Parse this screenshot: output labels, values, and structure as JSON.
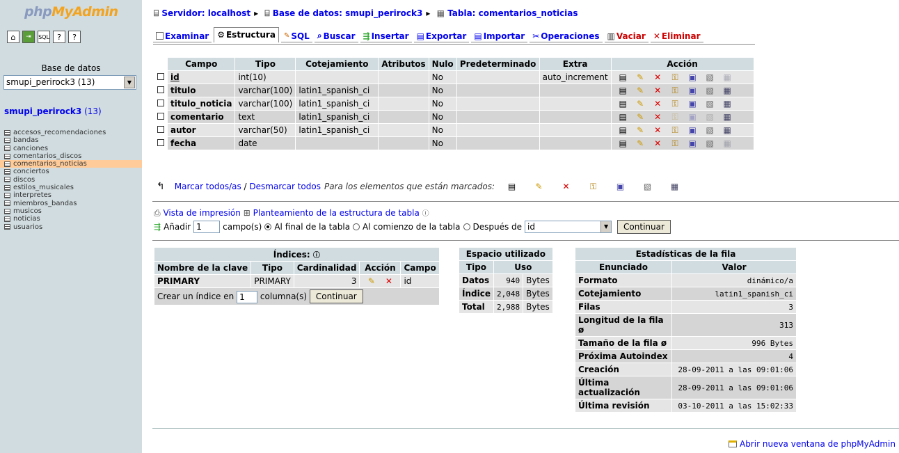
{
  "sidebar": {
    "logo_php": "php",
    "logo_myadmin": "MyAdmin",
    "db_label": "Base de datos",
    "db_select": "smupi_perirock3 (13)",
    "db_title": "smupi_perirock3",
    "db_count": "(13)",
    "tables": [
      "accesos_recomendaciones",
      "bandas",
      "canciones",
      "comentarios_discos",
      "comentarios_noticias",
      "conciertos",
      "discos",
      "estilos_musicales",
      "interpretes",
      "miembros_bandas",
      "musicos",
      "noticias",
      "usuarios"
    ],
    "selected_table": "comentarios_noticias"
  },
  "breadcrumb": {
    "server": "Servidor: localhost",
    "database": "Base de datos: smupi_perirock3",
    "table": "Tabla: comentarios_noticias"
  },
  "tabs": [
    "Examinar",
    "Estructura",
    "SQL",
    "Buscar",
    "Insertar",
    "Exportar",
    "Importar",
    "Operaciones",
    "Vaciar",
    "Eliminar"
  ],
  "structure": {
    "headers": [
      "Campo",
      "Tipo",
      "Cotejamiento",
      "Atributos",
      "Nulo",
      "Predeterminado",
      "Extra",
      "Acción"
    ],
    "rows": [
      {
        "campo": "id",
        "tipo": "int(10)",
        "cotejamiento": "",
        "atributos": "",
        "nulo": "No",
        "pred": "",
        "extra": "auto_increment"
      },
      {
        "campo": "titulo",
        "tipo": "varchar(100)",
        "cotejamiento": "latin1_spanish_ci",
        "atributos": "",
        "nulo": "No",
        "pred": "",
        "extra": ""
      },
      {
        "campo": "titulo_noticia",
        "tipo": "varchar(100)",
        "cotejamiento": "latin1_spanish_ci",
        "atributos": "",
        "nulo": "No",
        "pred": "",
        "extra": ""
      },
      {
        "campo": "comentario",
        "tipo": "text",
        "cotejamiento": "latin1_spanish_ci",
        "atributos": "",
        "nulo": "No",
        "pred": "",
        "extra": ""
      },
      {
        "campo": "autor",
        "tipo": "varchar(50)",
        "cotejamiento": "latin1_spanish_ci",
        "atributos": "",
        "nulo": "No",
        "pred": "",
        "extra": ""
      },
      {
        "campo": "fecha",
        "tipo": "date",
        "cotejamiento": "",
        "atributos": "",
        "nulo": "No",
        "pred": "",
        "extra": ""
      }
    ],
    "mark_all": "Marcar todos/as",
    "slash": "/",
    "unmark_all": "Desmarcar todos",
    "selected_hint": "Para los elementos que están marcados:"
  },
  "links": {
    "print_view": "Vista de impresión",
    "plan": "Planteamiento de la estructura de tabla"
  },
  "add": {
    "label": "Añadir",
    "count": "1",
    "fields_text": "campo(s)",
    "opt_end": "Al final de la tabla",
    "opt_start": "Al comienzo de la tabla",
    "opt_after": "Después de",
    "after_value": "id",
    "button": "Continuar"
  },
  "indexes": {
    "title": "Índices:",
    "headers": [
      "Nombre de la clave",
      "Tipo",
      "Cardinalidad",
      "Acción",
      "Campo"
    ],
    "row": {
      "name": "PRIMARY",
      "type": "PRIMARY",
      "card": "3",
      "field": "id"
    },
    "create_label": "Crear un índice en",
    "create_count": "1",
    "columns_text": "columna(s)",
    "button": "Continuar"
  },
  "space": {
    "title": "Espacio utilizado",
    "headers": [
      "Tipo",
      "Uso"
    ],
    "rows": [
      {
        "type": "Datos",
        "value": "940",
        "unit": "Bytes"
      },
      {
        "type": "Índice",
        "value": "2,048",
        "unit": "Bytes"
      },
      {
        "type": "Total",
        "value": "2,988",
        "unit": "Bytes"
      }
    ]
  },
  "stats": {
    "title": "Estadísticas de la fila",
    "headers": [
      "Enunciado",
      "Valor"
    ],
    "rows": [
      {
        "k": "Formato",
        "v": "dinámico/a"
      },
      {
        "k": "Cotejamiento",
        "v": "latin1_spanish_ci"
      },
      {
        "k": "Filas",
        "v": "3"
      },
      {
        "k": "Longitud de la fila ø",
        "v": "313"
      },
      {
        "k": "Tamaño de la fila ø",
        "v": "996 Bytes"
      },
      {
        "k": "Próxima Autoindex",
        "v": "4"
      },
      {
        "k": "Creación",
        "v": "28-09-2011 a las 09:01:06"
      },
      {
        "k": "Última actualización",
        "v": "28-09-2011 a las 09:01:06"
      },
      {
        "k": "Última revisión",
        "v": "03-10-2011 a las 15:02:33"
      }
    ]
  },
  "footer": {
    "new_window": "Abrir nueva ventana de phpMyAdmin"
  },
  "colors": {
    "sidebar_bg": "#D0DCE0",
    "header_bg": "#D0DCE0",
    "row_light": "#E5E5E5",
    "row_dark": "#D5D5D5",
    "selected": "#FFCC99",
    "link": "#0000EE"
  }
}
